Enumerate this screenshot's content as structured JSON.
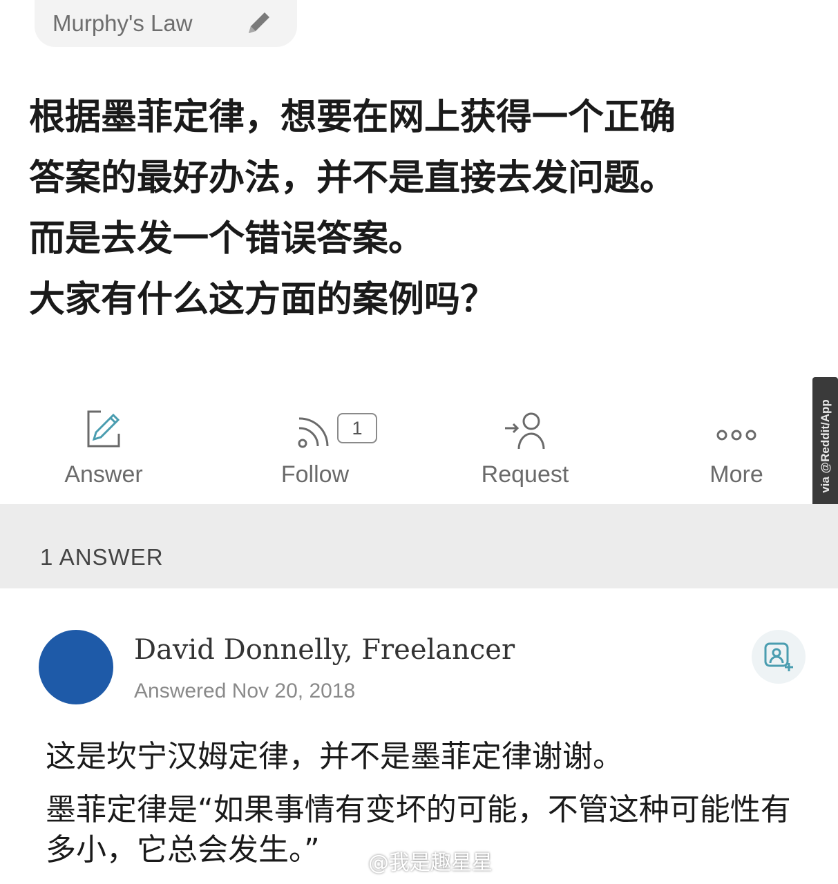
{
  "topic": {
    "label": "Murphy's Law",
    "edit_icon": "pencil-icon"
  },
  "question": {
    "lines": [
      "根据墨菲定律，想要在网上获得一个正确",
      "答案的最好办法，并不是直接去发问题。",
      "而是去发一个错误答案。",
      "大家有什么这方面的案例吗？"
    ]
  },
  "actions": [
    {
      "id": "answer",
      "label": "Answer",
      "icon": "edit-square-icon"
    },
    {
      "id": "follow",
      "label": "Follow",
      "icon": "rss-icon",
      "badge": "1"
    },
    {
      "id": "request",
      "label": "Request",
      "icon": "request-user-icon"
    },
    {
      "id": "more",
      "label": "More",
      "icon": "more-dots-icon"
    }
  ],
  "watermark": "via @Reddit/App",
  "answers": {
    "count_label": "1 ANSWER"
  },
  "answer": {
    "author": "David Donnelly, Freelancer",
    "date": "Answered Nov 20, 2018",
    "follow_icon": "follow-user-icon",
    "paragraphs": [
      "这是坎宁汉姆定律，并不是墨菲定律谢谢。",
      "墨菲定律是“如果事情有变坏的可能，不管这种可能性有多小，它总会发生。”"
    ]
  },
  "weibo_watermark": "@我是趣星星",
  "colors": {
    "accent": "#1e5aa8",
    "band": "#ececec",
    "muted_text": "#6a6a6a"
  }
}
